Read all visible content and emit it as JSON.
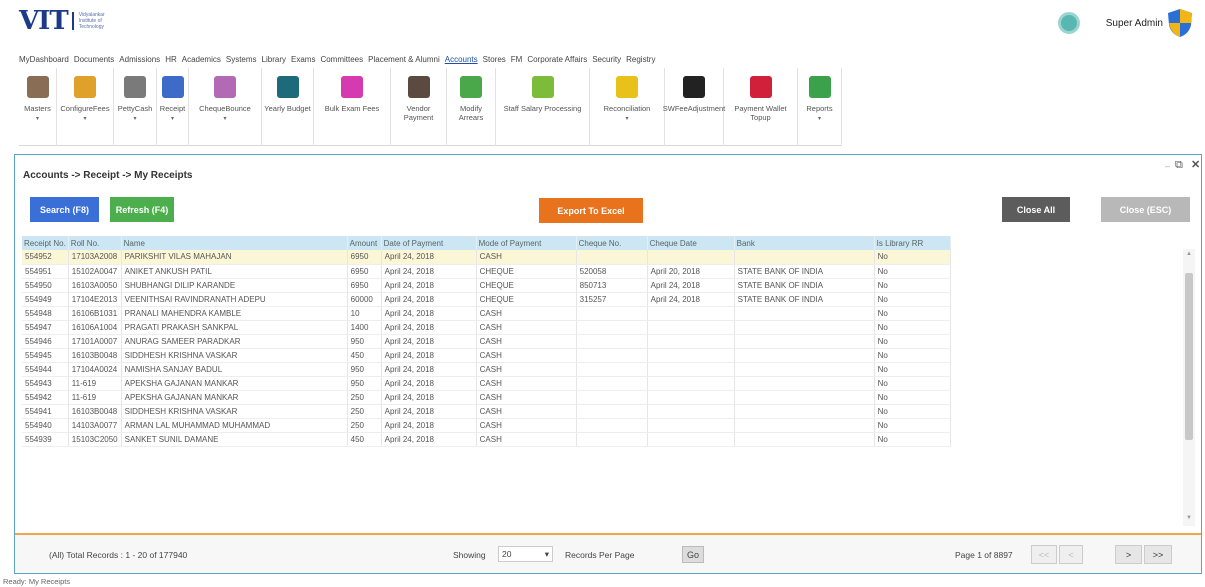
{
  "brand": {
    "logo": "VIT",
    "logo_sub": "Vidyalankar Institute of Technology"
  },
  "user": {
    "name": "Super Admin"
  },
  "menu": [
    "MyDashboard",
    "Documents",
    "Admissions",
    "HR",
    "Academics",
    "Systems",
    "Library",
    "Exams",
    "Committees",
    "Placement & Alumni",
    "Accounts",
    "Stores",
    "FM",
    "Corporate Affairs",
    "Security",
    "Registry"
  ],
  "menu_active": "Accounts",
  "toolbar": [
    {
      "label": "Masters",
      "icon": "masters-icon",
      "color": "#8a6d55",
      "caret": true
    },
    {
      "label": "ConfigureFees",
      "icon": "configure-fees-icon",
      "color": "#e0a12a",
      "caret": true
    },
    {
      "label": "PettyCash",
      "icon": "petty-cash-icon",
      "color": "#7a7a7a",
      "caret": true
    },
    {
      "label": "Receipt",
      "icon": "receipt-icon",
      "color": "#3d6bc7",
      "caret": true
    },
    {
      "label": "ChequeBounce",
      "icon": "cheque-bounce-icon",
      "color": "#b36ab5",
      "caret": true
    },
    {
      "label": "Yearly Budget",
      "icon": "yearly-budget-icon",
      "color": "#1d6b7a",
      "caret": false
    },
    {
      "label": "Bulk Exam Fees",
      "icon": "bulk-exam-fees-icon",
      "color": "#d63ab0",
      "caret": false
    },
    {
      "label": "Vendor Payment",
      "icon": "vendor-payment-icon",
      "color": "#5a4a40",
      "caret": false
    },
    {
      "label": "Modify Arrears",
      "icon": "modify-arrears-icon",
      "color": "#4aa84a",
      "caret": false
    },
    {
      "label": "Staff Salary Processing",
      "icon": "staff-salary-icon",
      "color": "#7dbb3a",
      "caret": false
    },
    {
      "label": "Reconciliation",
      "icon": "reconciliation-icon",
      "color": "#e8c21a",
      "caret": true
    },
    {
      "label": "SWFeeAdjustment",
      "icon": "sw-fee-adjustment-icon",
      "color": "#222222",
      "caret": false
    },
    {
      "label": "Payment Wallet Topup",
      "icon": "payment-wallet-icon",
      "color": "#d0203a",
      "caret": false
    },
    {
      "label": "Reports",
      "icon": "reports-icon",
      "color": "#3ba14a",
      "caret": true
    }
  ],
  "panel": {
    "title": "Accounts -> Receipt -> My Receipts",
    "search_label": "Search (F8)",
    "refresh_label": "Refresh (F4)",
    "export_label": "Export To Excel",
    "close_all_label": "Close All",
    "close_label": "Close (ESC)"
  },
  "colors": {
    "search": "#3a6fd8",
    "refresh": "#4cae4c",
    "export": "#e8731c",
    "close_all": "#5c5c5c",
    "close": "#b8b8b8"
  },
  "table": {
    "columns": [
      "Receipt No.",
      "Roll No.",
      "Name",
      "Amount",
      "Date of Payment",
      "Mode of Payment",
      "Cheque No.",
      "Cheque Date",
      "Bank",
      "Is Library RR"
    ],
    "rows": [
      [
        "554952",
        "17103A2008",
        "PARIKSHIT VILAS MAHAJAN",
        "6950",
        "April 24, 2018",
        "CASH",
        "",
        "",
        "",
        "No"
      ],
      [
        "554951",
        "15102A0047",
        "ANIKET ANKUSH PATIL",
        "6950",
        "April 24, 2018",
        "CHEQUE",
        "520058",
        "April 20, 2018",
        "STATE BANK OF INDIA",
        "No"
      ],
      [
        "554950",
        "16103A0050",
        "SHUBHANGI DILIP KARANDE",
        "6950",
        "April 24, 2018",
        "CHEQUE",
        "850713",
        "April 24, 2018",
        "STATE BANK OF INDIA",
        "No"
      ],
      [
        "554949",
        "17104E2013",
        "VEENITHSAI RAVINDRANATH ADEPU",
        "60000",
        "April 24, 2018",
        "CHEQUE",
        "315257",
        "April 24, 2018",
        "STATE BANK OF INDIA",
        "No"
      ],
      [
        "554948",
        "16106B1031",
        "PRANALI MAHENDRA KAMBLE",
        "10",
        "April 24, 2018",
        "CASH",
        "",
        "",
        "",
        "No"
      ],
      [
        "554947",
        "16106A1004",
        "PRAGATI PRAKASH SANKPAL",
        "1400",
        "April 24, 2018",
        "CASH",
        "",
        "",
        "",
        "No"
      ],
      [
        "554946",
        "17101A0007",
        "ANURAG SAMEER PARADKAR",
        "950",
        "April 24, 2018",
        "CASH",
        "",
        "",
        "",
        "No"
      ],
      [
        "554945",
        "16103B0048",
        "SIDDHESH KRISHNA VASKAR",
        "450",
        "April 24, 2018",
        "CASH",
        "",
        "",
        "",
        "No"
      ],
      [
        "554944",
        "17104A0024",
        "NAMISHA SANJAY BADUL",
        "950",
        "April 24, 2018",
        "CASH",
        "",
        "",
        "",
        "No"
      ],
      [
        "554943",
        "11-619",
        "APEKSHA GAJANAN MANKAR",
        "950",
        "April 24, 2018",
        "CASH",
        "",
        "",
        "",
        "No"
      ],
      [
        "554942",
        "11-619",
        "APEKSHA GAJANAN MANKAR",
        "250",
        "April 24, 2018",
        "CASH",
        "",
        "",
        "",
        "No"
      ],
      [
        "554941",
        "16103B0048",
        "SIDDHESH KRISHNA VASKAR",
        "250",
        "April 24, 2018",
        "CASH",
        "",
        "",
        "",
        "No"
      ],
      [
        "554940",
        "14103A0077",
        "ARMAN LAL MUHAMMAD MUHAMMAD",
        "250",
        "April 24, 2018",
        "CASH",
        "",
        "",
        "",
        "No"
      ],
      [
        "554939",
        "15103C2050",
        "SANKET SUNIL DAMANE",
        "450",
        "April 24, 2018",
        "CASH",
        "",
        "",
        "",
        "No"
      ]
    ]
  },
  "footer": {
    "total": "(All) Total Records : 1 - 20 of 177940",
    "showing": "Showing",
    "per_page_value": "20",
    "records_per_page": "Records Per Page",
    "go": "Go",
    "page_info": "Page 1 of 8897",
    "first": "<<",
    "prev": "<",
    "next": ">",
    "last": ">>"
  },
  "status": "Ready: My Receipts"
}
